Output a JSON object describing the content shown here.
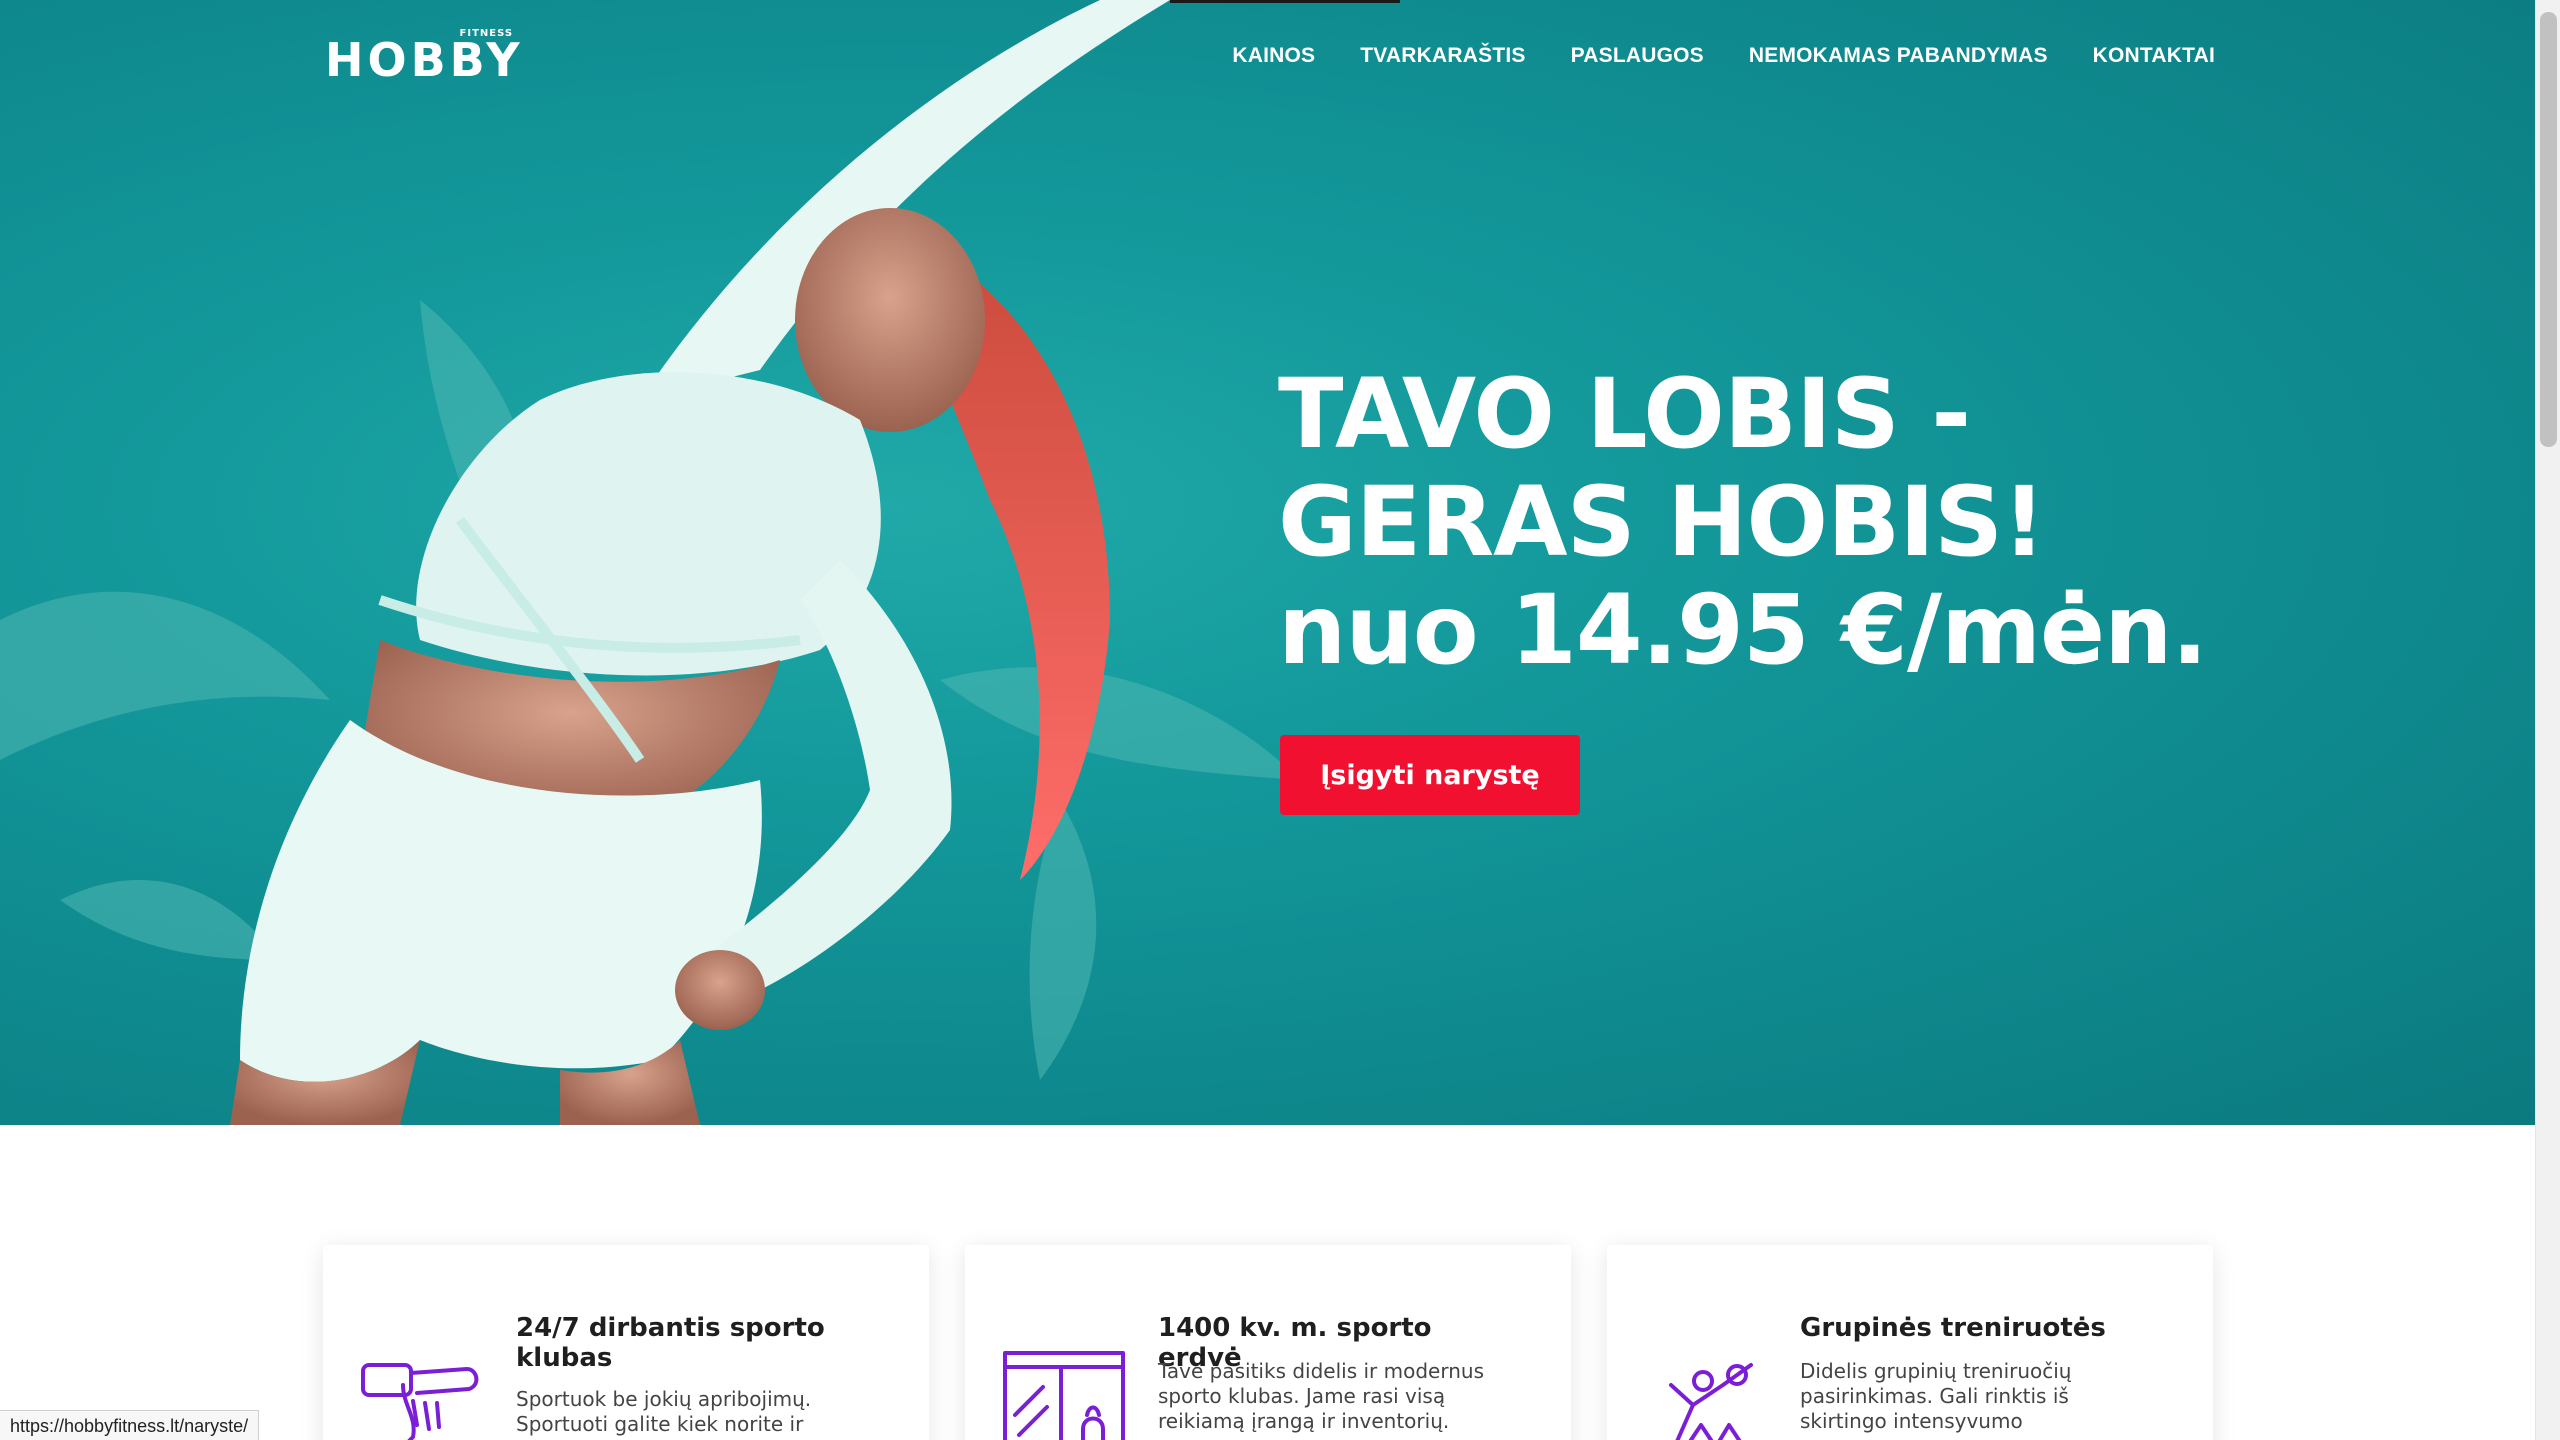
{
  "brand": {
    "name": "HOBBY",
    "sub": "FITNESS"
  },
  "nav": [
    "KAINOS",
    "TVARKARAŠTIS",
    "PASLAUGOS",
    "NEMOKAMAS PABANDYMAS",
    "KONTAKTAI"
  ],
  "hero": {
    "line1": "TAVO LOBIS -",
    "line2": "GERAS HOBIS!",
    "line3": "nuo 14.95 €/mėn.",
    "cta": "Įsigyti narystę"
  },
  "cards": [
    {
      "title": "24/7 dirbantis sporto klubas",
      "text": "Sportuok be jokių apribojimų. Sportuoti galite kiek norite ir",
      "icon": "watch-hand-icon"
    },
    {
      "title": "1400 kv. m. sporto erdvė",
      "text": "Tave pasitiks didelis ir modernus sporto klubas. Jame rasi visą reikiamą įrangą ir inventorių.",
      "icon": "gym-space-icon"
    },
    {
      "title": "Grupinės treniruotės",
      "text": "Didelis grupinių treniruočių pasirinkimas. Gali rinktis iš skirtingo intensyvumo",
      "icon": "group-training-icon"
    }
  ],
  "status_url": "https://hobbyfitness.lt/naryste/",
  "colors": {
    "accent": "#f1102f",
    "hero": "#149a9c",
    "icon": "#7b1fd6"
  }
}
